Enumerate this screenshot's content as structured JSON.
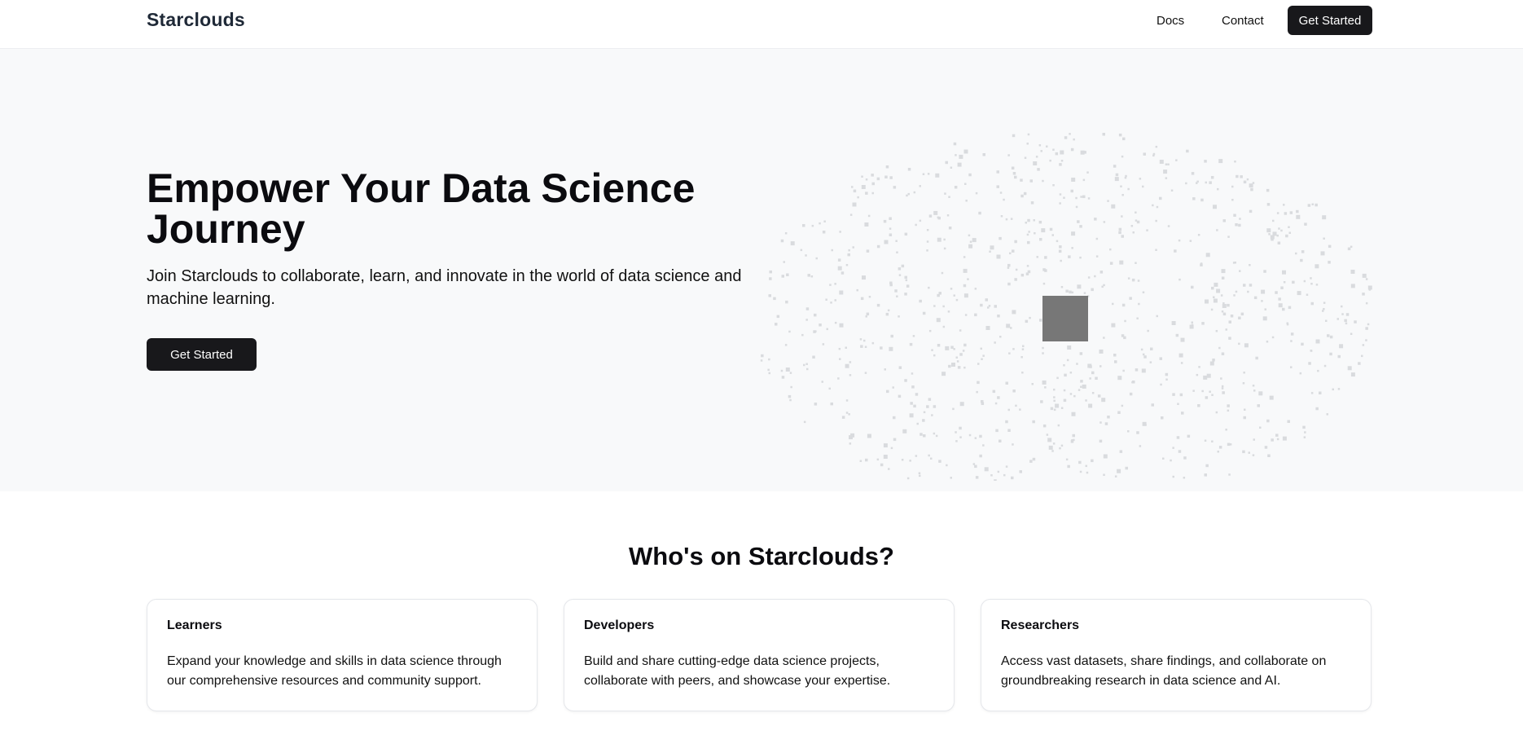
{
  "nav": {
    "brand": "Starclouds",
    "links": [
      "Docs",
      "Contact"
    ],
    "cta_label": "Get Started"
  },
  "hero": {
    "title": "Empower Your Data Science Journey",
    "subtitle": "Join Starclouds to collaborate, learn, and innovate in the world of data science and machine learning.",
    "cta_label": "Get Started",
    "visual": "particle-field"
  },
  "who": {
    "title": "Who's on Starclouds?",
    "cards": [
      {
        "title": "Learners",
        "description": "Expand your knowledge and skills in data science through our comprehensive resources and community support."
      },
      {
        "title": "Developers",
        "description": "Build and share cutting-edge data science projects, collaborate with peers, and showcase your expertise."
      },
      {
        "title": "Researchers",
        "description": "Access vast datasets, share findings, and collaborate on groundbreaking research in data science and AI."
      }
    ]
  },
  "colors": {
    "primary_button": "#18181b",
    "hero_background": "#f8f9fa",
    "brand_text": "#1f2937",
    "particle": "#d9dbde",
    "center_square": "#777777"
  }
}
